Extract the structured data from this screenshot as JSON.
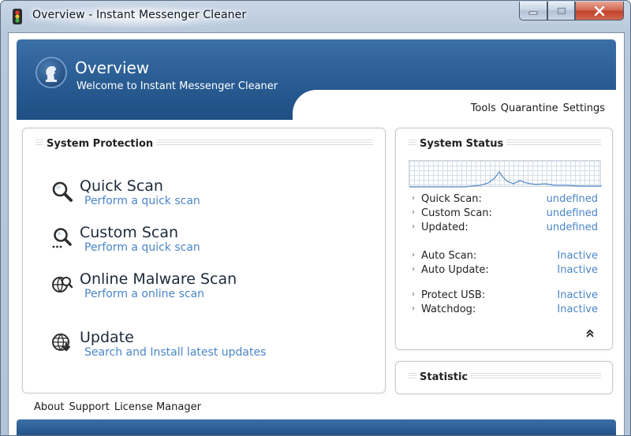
{
  "window": {
    "title": "Overview - Instant Messenger Cleaner",
    "controls": {
      "minimize": "minimize",
      "maximize": "maximize",
      "close": "close"
    }
  },
  "header": {
    "title": "Overview",
    "subtitle": "Welcome to Instant Messenger Cleaner"
  },
  "topnav": {
    "tools": "Tools",
    "quarantine": "Quarantine",
    "settings": "Settings"
  },
  "protection": {
    "title": "System Protection",
    "items": [
      {
        "icon": "magnifier-icon",
        "title": "Quick Scan",
        "link": "Perform a quick scan"
      },
      {
        "icon": "custom-scan-icon",
        "title": "Custom Scan",
        "link": "Perform a quick scan"
      },
      {
        "icon": "globe-search-icon",
        "title": "Online Malware Scan",
        "link": "Perform a online scan"
      },
      {
        "icon": "globe-download-icon",
        "title": "Update",
        "link": "Search and Install latest updates"
      }
    ]
  },
  "status": {
    "title": "System Status",
    "rows": [
      {
        "label": "Quick Scan:",
        "value": "undefined"
      },
      {
        "label": "Custom Scan:",
        "value": "undefined"
      },
      {
        "label": "Updated:",
        "value": "undefined"
      },
      {
        "label": "Auto Scan:",
        "value": "Inactive"
      },
      {
        "label": "Auto Update:",
        "value": "Inactive"
      },
      {
        "label": "Protect USB:",
        "value": "Inactive"
      },
      {
        "label": "Watchdog:",
        "value": "Inactive"
      }
    ],
    "collapse_icon": "double-chevron-up-icon"
  },
  "statistic": {
    "title": "Statistic"
  },
  "bottom": {
    "about": "About",
    "support": "Support",
    "license": "License Manager"
  },
  "colors": {
    "accent": "#2a5d94",
    "link": "#4a86c8",
    "close": "#c0432a"
  }
}
